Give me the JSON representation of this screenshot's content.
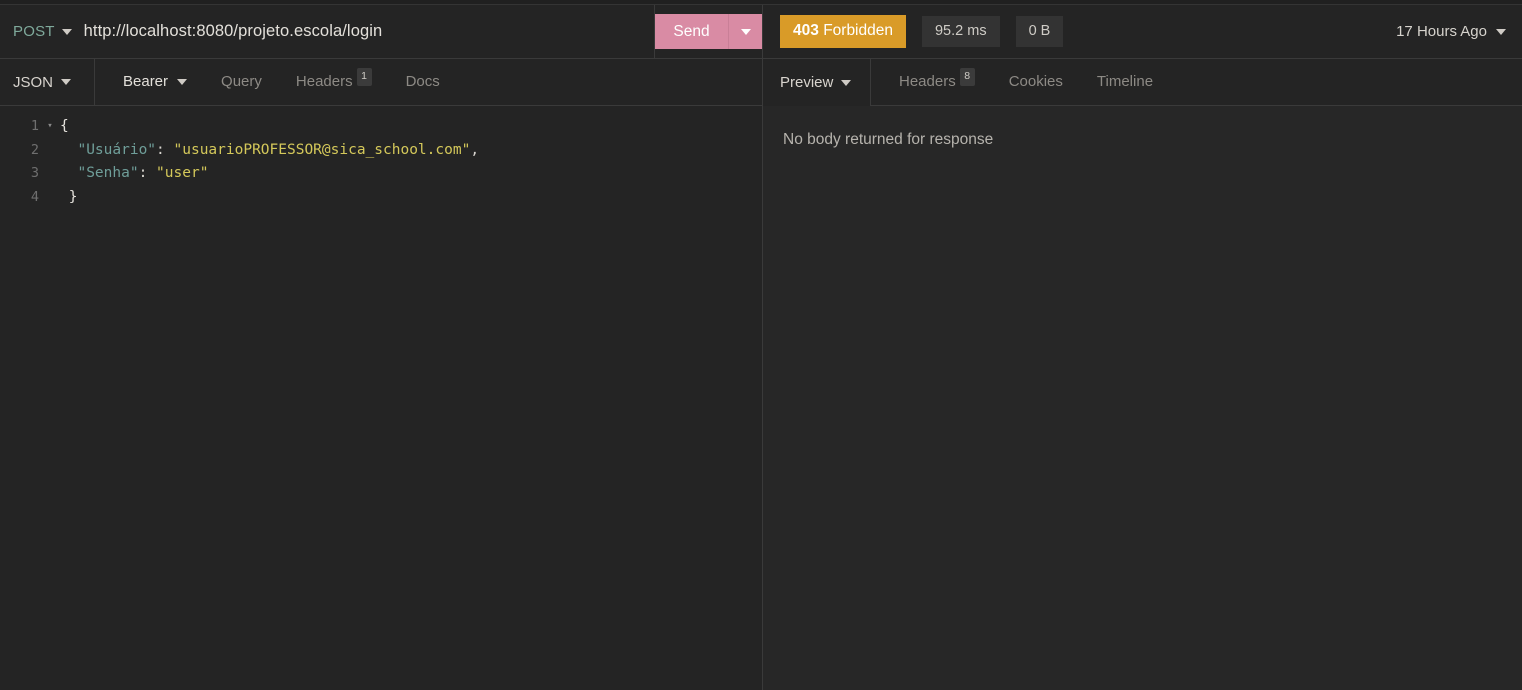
{
  "request": {
    "method": "POST",
    "url": "http://localhost:8080/projeto.escola/login",
    "send_label": "Send",
    "body_type": "JSON",
    "auth_type": "Bearer",
    "tabs": [
      {
        "label": "Query",
        "badge": "",
        "active": false
      },
      {
        "label": "Headers",
        "badge": "1",
        "active": false
      },
      {
        "label": "Docs",
        "badge": "",
        "active": false
      }
    ],
    "body": {
      "language": "json",
      "lines": [
        {
          "number": "1",
          "fold": "▾",
          "tokens": [
            {
              "t": "{",
              "c": "k-brace"
            }
          ]
        },
        {
          "number": "2",
          "fold": "",
          "tokens": [
            {
              "t": "  \"Usuário\"",
              "c": "k-key"
            },
            {
              "t": ": ",
              "c": "k-punct"
            },
            {
              "t": "\"usuarioPROFESSOR@sica_school.com\"",
              "c": "k-str"
            },
            {
              "t": ",",
              "c": "k-punct"
            }
          ]
        },
        {
          "number": "3",
          "fold": "",
          "tokens": [
            {
              "t": "  \"Senha\"",
              "c": "k-key"
            },
            {
              "t": ": ",
              "c": "k-punct"
            },
            {
              "t": "\"user\"",
              "c": "k-str"
            }
          ]
        },
        {
          "number": "4",
          "fold": "",
          "tokens": [
            {
              "t": " }",
              "c": "k-brace"
            }
          ]
        }
      ]
    }
  },
  "response": {
    "status_code": "403",
    "status_text": "Forbidden",
    "time": "95.2 ms",
    "size": "0 B",
    "time_ago": "17 Hours Ago",
    "view_mode": "Preview",
    "tabs": [
      {
        "label": "Headers",
        "badge": "8",
        "active": false
      },
      {
        "label": "Cookies",
        "badge": "",
        "active": false
      },
      {
        "label": "Timeline",
        "badge": "",
        "active": false
      }
    ],
    "empty_message": "No body returned for response"
  },
  "colors": {
    "background": "#242424",
    "panel": "#272727",
    "send_button": "#d98ba4",
    "status_badge": "#d99b28",
    "method_text": "#7fa99b",
    "json_key": "#6f9e99",
    "json_string": "#d4c85a",
    "border": "#3a3a3a"
  }
}
